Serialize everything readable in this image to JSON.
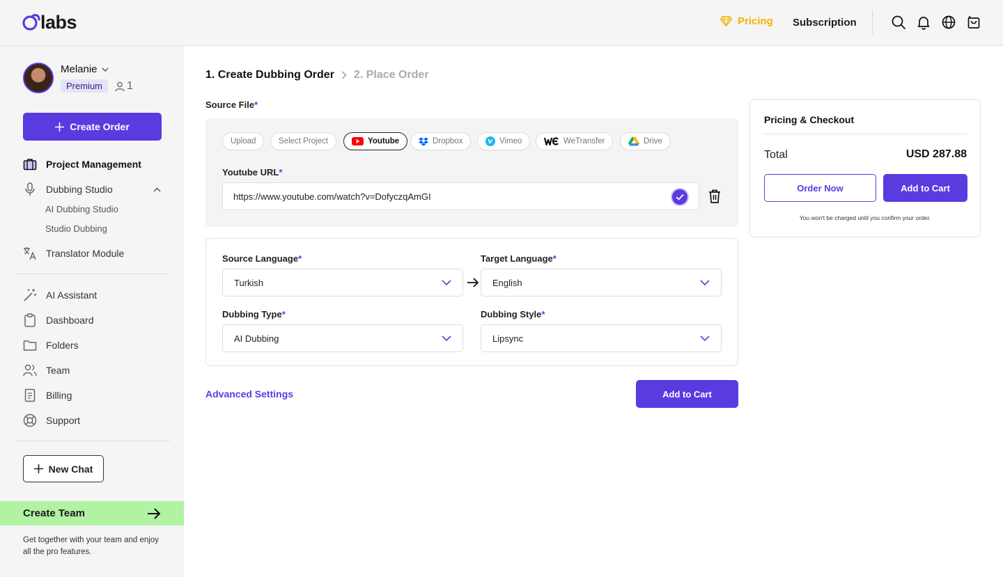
{
  "brand": {
    "logo_text": "labs",
    "accent_color": "#5a3be0",
    "pricing_color": "#f0b400"
  },
  "header": {
    "pricing_label": "Pricing",
    "subscription_label": "Subscription",
    "icons": [
      "search-icon",
      "bell-icon",
      "globe-icon",
      "cart-icon"
    ]
  },
  "user": {
    "name": "Melanie",
    "plan_badge": "Premium",
    "seat_count": "1"
  },
  "sidebar": {
    "create_order_label": "Create Order",
    "items": [
      {
        "label": "Project Management",
        "icon": "briefcase-icon",
        "active": true
      },
      {
        "label": "Dubbing Studio",
        "icon": "microphone-icon",
        "expanded": true,
        "children": [
          "AI Dubbing Studio",
          "Studio Dubbing"
        ]
      },
      {
        "label": "Translator Module",
        "icon": "translate-icon"
      }
    ],
    "tools": [
      {
        "label": "AI Assistant",
        "icon": "magic-wand-icon"
      },
      {
        "label": "Dashboard",
        "icon": "clipboard-icon"
      },
      {
        "label": "Folders",
        "icon": "folder-icon"
      },
      {
        "label": "Team",
        "icon": "team-icon"
      },
      {
        "label": "Billing",
        "icon": "document-icon"
      },
      {
        "label": "Support",
        "icon": "lifebuoy-icon"
      }
    ],
    "new_chat_label": "New Chat",
    "create_team_label": "Create Team",
    "team_description": "Get together with your team and enjoy all the pro features."
  },
  "breadcrumb": {
    "step1": "1. Create Dubbing Order",
    "step2": "2. Place Order"
  },
  "source": {
    "label": "Source File",
    "required_mark": "*",
    "tabs": [
      {
        "label": "Upload",
        "selected": false
      },
      {
        "label": "Select Project",
        "selected": false
      },
      {
        "label": "Youtube",
        "selected": true,
        "icon": "youtube-icon"
      },
      {
        "label": "Dropbox",
        "selected": false,
        "icon": "dropbox-icon"
      },
      {
        "label": "Vimeo",
        "selected": false,
        "icon": "vimeo-icon"
      },
      {
        "label": "WeTransfer",
        "selected": false,
        "icon": "wetransfer-icon"
      },
      {
        "label": "Drive",
        "selected": false,
        "icon": "drive-icon"
      }
    ],
    "url_label": "Youtube URL",
    "url_value": "https://www.youtube.com/watch?v=DofyczqAmGI"
  },
  "settings": {
    "source_language_label": "Source Language",
    "source_language_value": "Turkish",
    "target_language_label": "Target Language",
    "target_language_value": "English",
    "dubbing_type_label": "Dubbing Type",
    "dubbing_type_value": "AI Dubbing",
    "dubbing_style_label": "Dubbing Style",
    "dubbing_style_value": "Lipsync"
  },
  "actions": {
    "advanced_settings_label": "Advanced Settings",
    "add_to_cart_label": "Add to Cart"
  },
  "checkout": {
    "title": "Pricing & Checkout",
    "total_label": "Total",
    "total_value": "USD 287.88",
    "order_now_label": "Order Now",
    "add_to_cart_label": "Add to Cart",
    "note": "You won't be charged until you confirm your order."
  }
}
